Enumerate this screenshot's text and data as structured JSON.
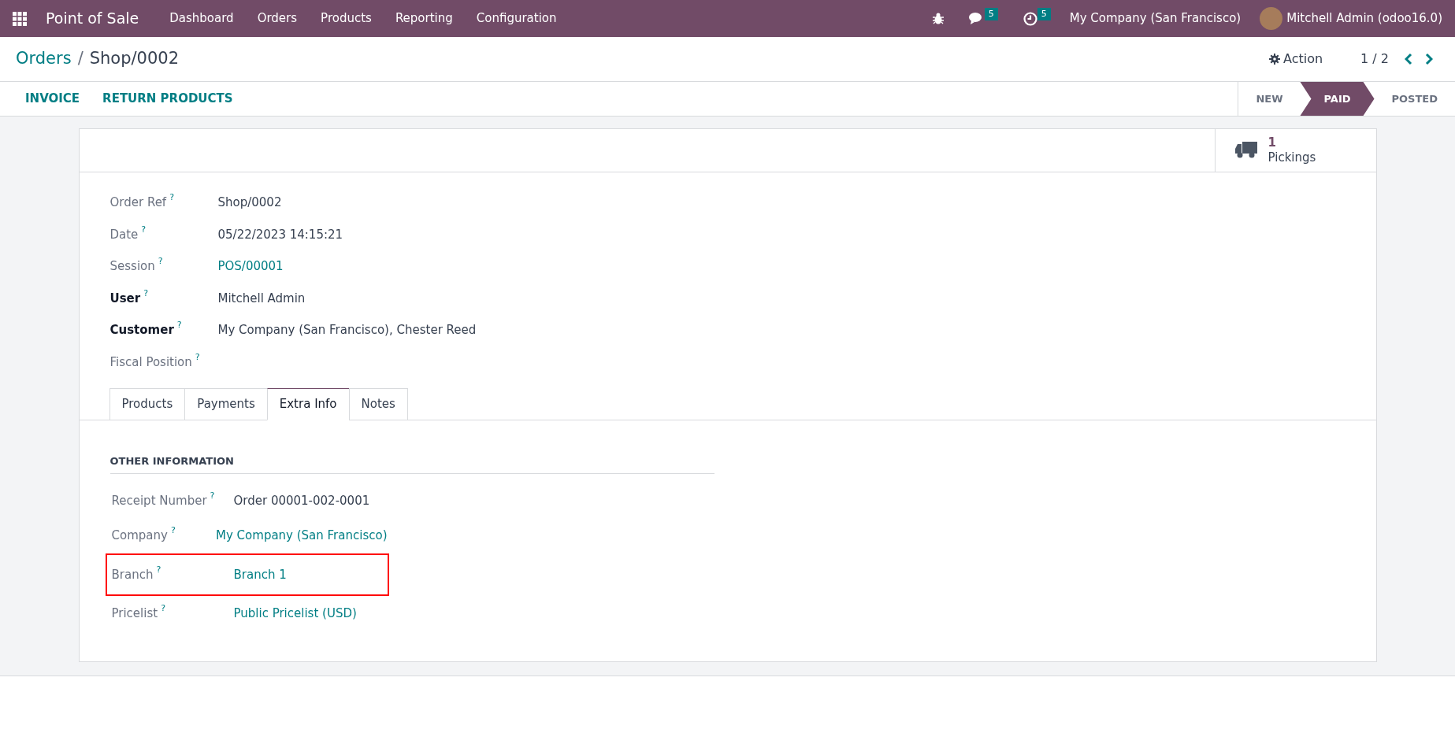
{
  "navbar": {
    "app_name": "Point of Sale",
    "menu": [
      "Dashboard",
      "Orders",
      "Products",
      "Reporting",
      "Configuration"
    ],
    "messages_count": "5",
    "activities_count": "5",
    "company": "My Company (San Francisco)",
    "user": "Mitchell Admin (odoo16.0)"
  },
  "breadcrumb": {
    "parent": "Orders",
    "separator": "/",
    "current": "Shop/0002"
  },
  "action_label": "Action",
  "pager": "1 / 2",
  "buttons": [
    "INVOICE",
    "RETURN PRODUCTS"
  ],
  "stages": [
    {
      "label": "NEW",
      "selected": false
    },
    {
      "label": "PAID",
      "selected": true
    },
    {
      "label": "POSTED",
      "selected": false
    }
  ],
  "stat_button": {
    "value": "1",
    "label": "Pickings"
  },
  "fields": [
    {
      "label": "Order Ref",
      "help": "?",
      "value": "Shop/0002",
      "required": false,
      "link": false
    },
    {
      "label": "Date",
      "help": "?",
      "value": "05/22/2023 14:15:21",
      "required": false,
      "link": false
    },
    {
      "label": "Session",
      "help": "?",
      "value": "POS/00001",
      "required": false,
      "link": true
    },
    {
      "label": "User",
      "help": "?",
      "value": "Mitchell Admin",
      "required": true,
      "link": false
    },
    {
      "label": "Customer",
      "help": "?",
      "value": "My Company (San Francisco), Chester Reed",
      "required": true,
      "link": false
    },
    {
      "label": "Fiscal Position",
      "help": "?",
      "required": false
    }
  ],
  "tabs": [
    {
      "label": "Products",
      "selected": false
    },
    {
      "label": "Payments",
      "selected": false
    },
    {
      "label": "Extra Info",
      "selected": true
    },
    {
      "label": "Notes",
      "selected": false
    }
  ],
  "section_title": "OTHER INFORMATION",
  "extra_fields": [
    {
      "label": "Receipt Number",
      "help": "?",
      "value": "Order 00001-002-0001",
      "link": false,
      "highlighted": false
    },
    {
      "label": "Company",
      "help": "?",
      "value": "My Company (San Francisco)",
      "link": true,
      "highlighted": false
    },
    {
      "label": "Branch",
      "help": "?",
      "value": "Branch 1",
      "link": true,
      "highlighted": true
    },
    {
      "label": "Pricelist",
      "help": "?",
      "value": "Public Pricelist (USD)",
      "link": true,
      "highlighted": false
    }
  ]
}
